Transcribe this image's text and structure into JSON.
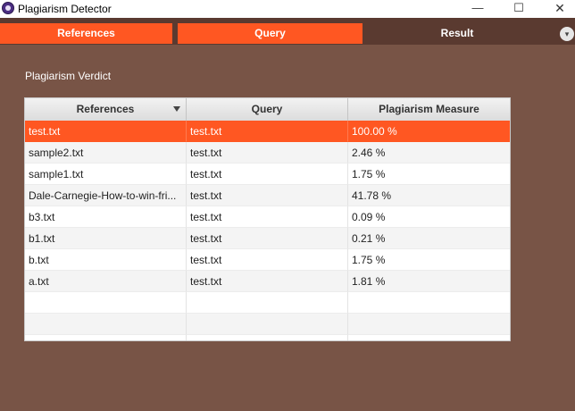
{
  "window": {
    "title": "Plagiarism Detector",
    "minimize": "—",
    "maximize": "☐",
    "close": "✕"
  },
  "tabs": [
    {
      "label": "References"
    },
    {
      "label": "Query"
    },
    {
      "label": "Result"
    }
  ],
  "tab_menu_glyph": "▾",
  "verdict_label": "Plagiarism Verdict",
  "table": {
    "columns": [
      "References",
      "Query",
      "Plagiarism Measure"
    ],
    "sorted_column": "References",
    "selected_row": 0,
    "rows": [
      [
        "test.txt",
        "test.txt",
        "100.00 %"
      ],
      [
        "sample2.txt",
        "test.txt",
        "2.46 %"
      ],
      [
        "sample1.txt",
        "test.txt",
        "1.75 %"
      ],
      [
        "Dale-Carnegie-How-to-win-fri...",
        "test.txt",
        "41.78 %"
      ],
      [
        "b3.txt",
        "test.txt",
        "0.09 %"
      ],
      [
        "b1.txt",
        "test.txt",
        "0.21 %"
      ],
      [
        "b.txt",
        "test.txt",
        "1.75 %"
      ],
      [
        "a.txt",
        "test.txt",
        "1.81 %"
      ],
      [
        "",
        "",
        ""
      ],
      [
        "",
        "",
        ""
      ],
      [
        "",
        "",
        ""
      ]
    ]
  },
  "colors": {
    "accent": "#ff5722",
    "background": "#785446",
    "tabstrip": "#5a3a30"
  }
}
